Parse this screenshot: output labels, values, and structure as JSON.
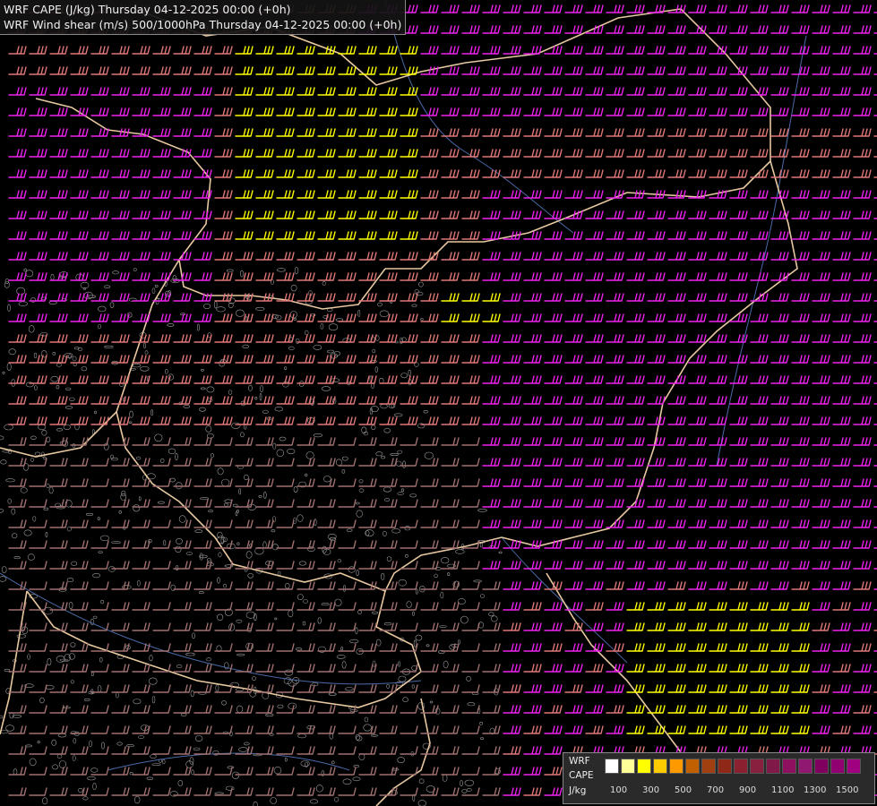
{
  "title": {
    "line1": "WRF CAPE (J/kg) Thursday 04-12-2025 00:00 (+0h)",
    "line2": "WRF Wind shear (m/s) 500/1000hPa Thursday 04-12-2025 00:00 (+0h)"
  },
  "legend": {
    "name_line1": "WRF",
    "name_line2": "CAPE",
    "unit": "J/kg",
    "ticks": [
      "100",
      "300",
      "500",
      "700",
      "900",
      "1100",
      "1300",
      "1500"
    ],
    "colors": [
      "#ffffff",
      "#ffff99",
      "#ffff00",
      "#ffcc00",
      "#ff9900",
      "#c06000",
      "#a04010",
      "#902818",
      "#8a2030",
      "#882040",
      "#801848",
      "#901060",
      "#901870",
      "#800060",
      "#900070",
      "#a00080"
    ]
  },
  "barb_colors": {
    "weak": "#a07070",
    "medium": "#e07878",
    "strong": "#ee22ee",
    "cape": "#ffff00"
  },
  "map_colors": {
    "border": "#e8c8a0",
    "river": "#4a6aa8",
    "terrain": "#9a9a9a"
  }
}
